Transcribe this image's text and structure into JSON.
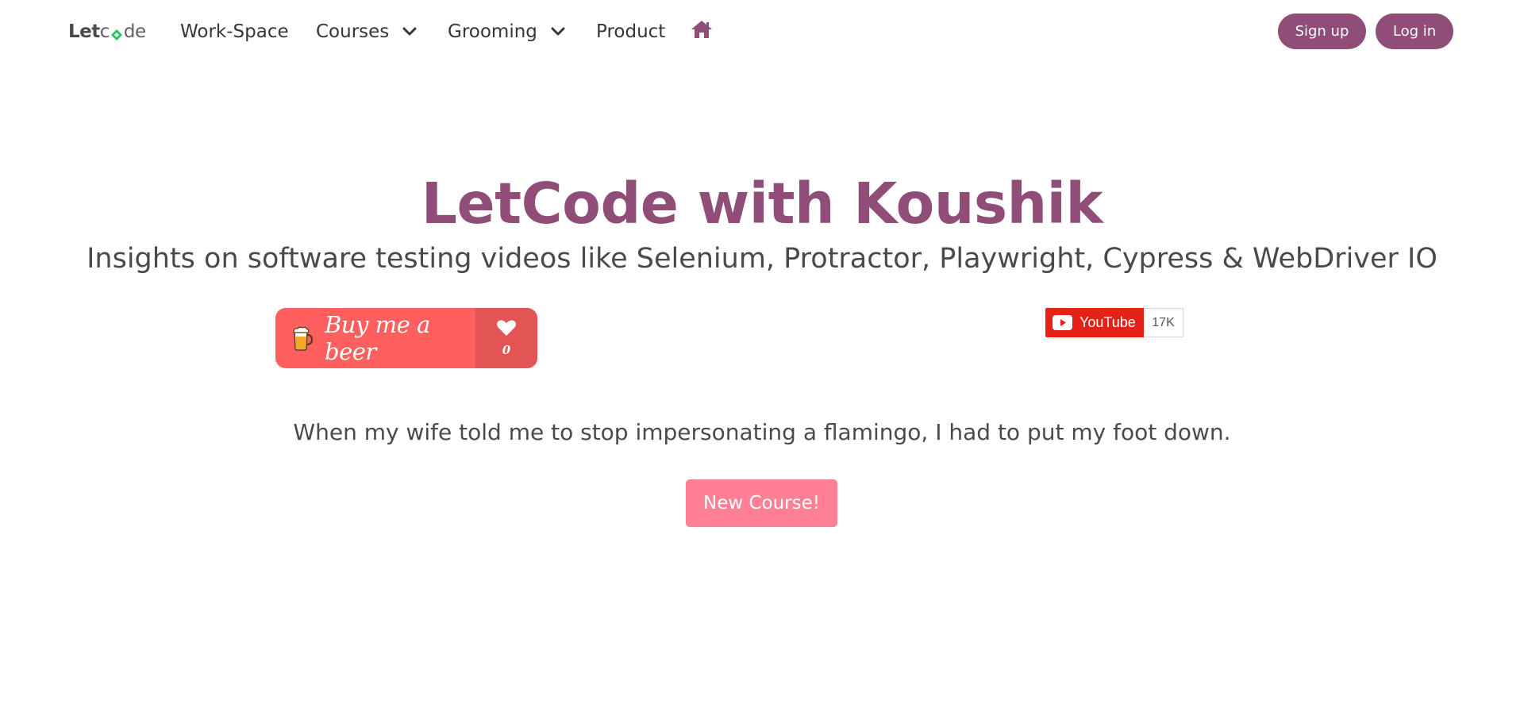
{
  "navbar": {
    "logo": {
      "part1": "Let",
      "part2": "c",
      "part3": "de"
    },
    "items": [
      {
        "label": "Work-Space"
      },
      {
        "label": "Courses",
        "has_dropdown": true
      },
      {
        "label": "Grooming",
        "has_dropdown": true
      },
      {
        "label": "Product"
      }
    ],
    "home_icon": "home-icon",
    "signup_label": "Sign up",
    "login_label": "Log in"
  },
  "hero": {
    "title": "LetCode with Koushik",
    "subtitle": "Insights on software testing videos like Selenium, Protractor, Playwright, Cypress & WebDriver IO"
  },
  "buy_me_a_beer": {
    "label": "Buy me a beer",
    "count": "0",
    "icons": [
      "beer-icon",
      "heart-icon"
    ]
  },
  "youtube": {
    "label": "YouTube",
    "count": "17K",
    "icon": "youtube-icon"
  },
  "joke": "When my wife told me to stop impersonating a flamingo, I had to put my foot down.",
  "new_course_label": "New Course!",
  "colors": {
    "brand": "#8f4d78",
    "beer_bg": "#ff5f5f",
    "beer_count_bg": "#e35455",
    "youtube_red": "#e62117",
    "new_course_bg": "#ff7f95",
    "logo_accent": "#22c55e"
  }
}
